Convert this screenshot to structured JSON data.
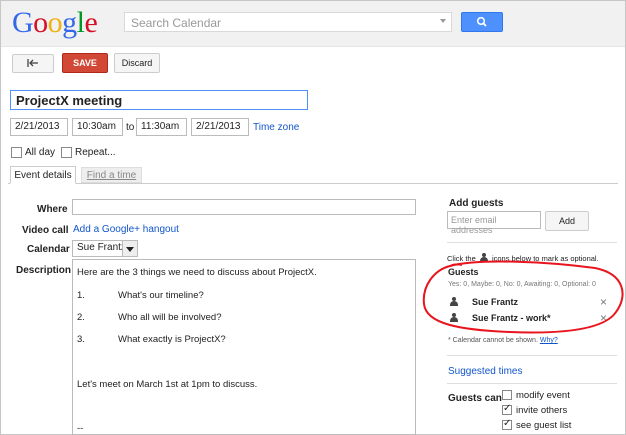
{
  "header": {
    "logo_text": "Google",
    "logo_colors": [
      "#3369e8",
      "#d50f25",
      "#eeb211",
      "#3369e8",
      "#009925",
      "#d50f25"
    ],
    "search_placeholder": "Search Calendar"
  },
  "toolbar": {
    "save_label": "SAVE",
    "discard_label": "Discard"
  },
  "event": {
    "title": "ProjectX meeting",
    "start_date": "2/21/2013",
    "start_time": "10:30am",
    "to_label": "to",
    "end_time": "11:30am",
    "end_date": "2/21/2013",
    "timezone_link": "Time zone",
    "all_day_label": "All day",
    "repeat_label": "Repeat..."
  },
  "tabs": [
    {
      "label": "Event details"
    },
    {
      "label": "Find a time"
    }
  ],
  "details": {
    "where_label": "Where",
    "where_value": "",
    "videocall_label": "Video call",
    "hangout_link": "Add a Google+ hangout",
    "calendar_label": "Calendar",
    "calendar_value": "Sue Frantz",
    "description_label": "Description",
    "description_lines": [
      "Here are the 3 things we need to discuss about ProjectX.",
      "1.",
      "What's our timeline?",
      "2.",
      "Who all will be involved?",
      "3.",
      "What exactly is ProjectX?",
      "Let's meet on March 1st at 1pm to discuss.",
      "--"
    ]
  },
  "guests_panel": {
    "add_guests_title": "Add guests",
    "email_placeholder": "Enter email addresses",
    "add_button": "Add",
    "optional_hint_pre": "Click the",
    "optional_hint_post": "icons below to mark as optional.",
    "guests_title": "Guests",
    "rsvp_summary": "Yes: 0, Maybe: 0, No: 0, Awaiting: 0, Optional: 0",
    "guest_list": [
      {
        "name": "Sue Frantz"
      },
      {
        "name": "Sue Frantz - work*"
      }
    ],
    "remove_glyph": "×",
    "calendar_note_pre": "* Calendar cannot be shown.",
    "calendar_note_link": "Why?",
    "suggested_times": "Suggested times",
    "guests_can_label": "Guests can",
    "permissions": [
      {
        "label": "modify event",
        "checked": false
      },
      {
        "label": "invite others",
        "checked": true
      },
      {
        "label": "see guest list",
        "checked": true
      }
    ]
  },
  "colors": {
    "accent": "#4d90fe",
    "save": "#d14836",
    "annotation": "#e8141e",
    "link": "#1155cc"
  }
}
